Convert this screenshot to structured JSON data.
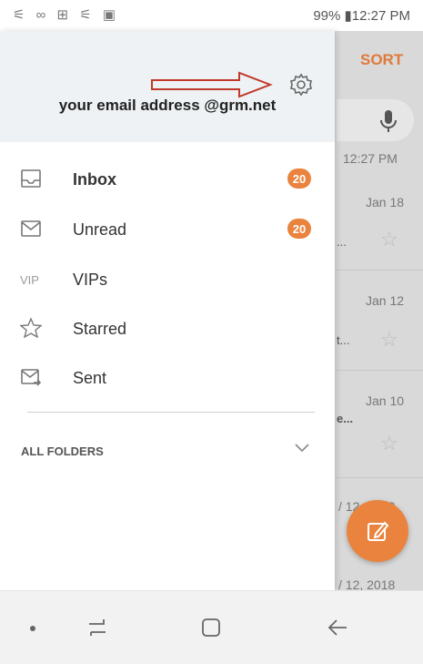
{
  "status_bar": {
    "left_icons": "⚟ ∞ ⊞ ⚟ ▣",
    "right_text": "99% ▮12:27 PM"
  },
  "background": {
    "sort_label": "SORT",
    "rows": [
      {
        "date": "12:27 PM",
        "snippet": ""
      },
      {
        "date": "Jan 18",
        "snippet": "..."
      },
      {
        "date": "Jan 12",
        "snippet": "t..."
      },
      {
        "date": "Jan 10",
        "snippet": "e..."
      },
      {
        "date": "/ 12, 2018",
        "snippet": ""
      },
      {
        "date": "/ 12, 2018",
        "snippet": ""
      }
    ]
  },
  "drawer": {
    "account_email": "your email address @grm.net",
    "items": [
      {
        "label": "Inbox",
        "badge": "20",
        "icon": "inbox-icon"
      },
      {
        "label": "Unread",
        "badge": "20",
        "icon": "envelope-icon"
      },
      {
        "label": "VIPs",
        "badge": "",
        "icon_text": "VIP"
      },
      {
        "label": "Starred",
        "badge": "",
        "icon": "star-icon"
      },
      {
        "label": "Sent",
        "badge": "",
        "icon": "sent-icon"
      }
    ],
    "all_folders_label": "ALL FOLDERS"
  },
  "colors": {
    "accent": "#e9833d",
    "header_bg": "#eef2f4",
    "annotation_arrow": "#c0392b"
  }
}
